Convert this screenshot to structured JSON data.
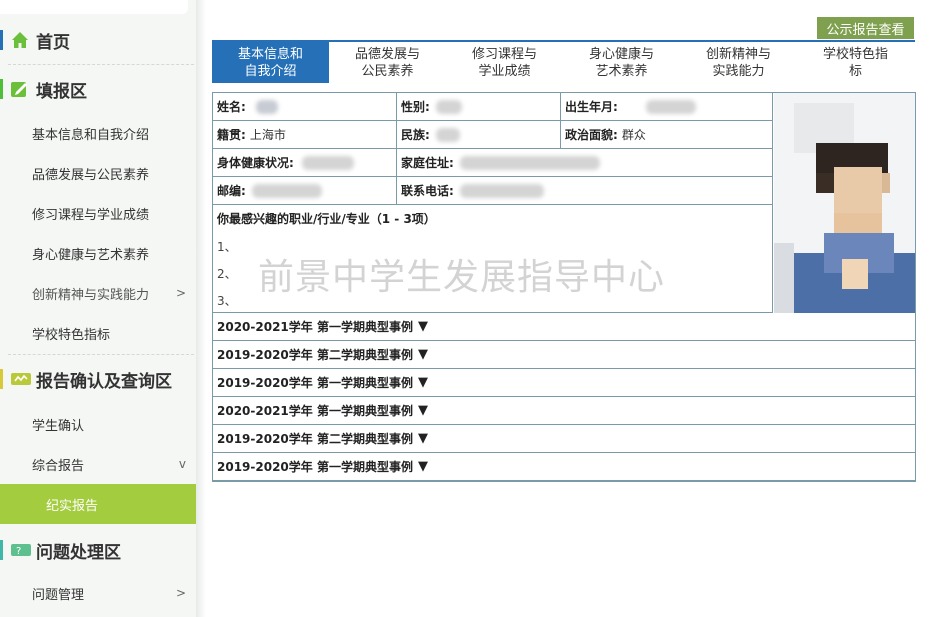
{
  "sidebar": {
    "home_label": "首页",
    "fill_section": "填报区",
    "fill_items": [
      {
        "label": "基本信息和自我介绍"
      },
      {
        "label": "品德发展与公民素养"
      },
      {
        "label": "修习课程与学业成绩"
      },
      {
        "label": "身心健康与艺术素养"
      },
      {
        "label": "创新精神与实践能力",
        "chevron": ">"
      },
      {
        "label": "学校特色指标"
      }
    ],
    "report_section": "报告确认及查询区",
    "report_items": [
      {
        "label": "学生确认"
      },
      {
        "label": "综合报告",
        "chevron": "v"
      },
      {
        "label": "纪实报告"
      }
    ],
    "issue_section": "问题处理区",
    "issue_items": [
      {
        "label": "问题管理",
        "chevron": ">"
      }
    ]
  },
  "public_report_button": "公示报告查看",
  "tabs": [
    {
      "label": "基本信息和\n自我介绍"
    },
    {
      "label": "品德发展与\n公民素养"
    },
    {
      "label": "修习课程与\n学业成绩"
    },
    {
      "label": "身心健康与\n艺术素养"
    },
    {
      "label": "创新精神与\n实践能力"
    },
    {
      "label": "学校特色指\n标"
    }
  ],
  "form": {
    "name_label": "姓名:",
    "gender_label": "性别:",
    "birth_label": "出生年月:",
    "native_label": "籍贯:",
    "native_value": "上海市",
    "ethnic_label": "民族:",
    "political_label": "政治面貌:",
    "political_value": "群众",
    "health_label": "身体健康状况:",
    "address_label": "家庭住址:",
    "zip_label": "邮编:",
    "phone_label": "联系电话:",
    "interest_title": "你最感兴趣的职业/行业/专业（1 - 3项）",
    "interest_lines": [
      "1、",
      "2、",
      "3、"
    ]
  },
  "case_rows": [
    {
      "label": "2020-2021学年 第一学期典型事例"
    },
    {
      "label": "2019-2020学年 第二学期典型事例"
    },
    {
      "label": "2019-2020学年 第一学期典型事例"
    },
    {
      "label": "2020-2021学年 第一学期典型事例"
    },
    {
      "label": "2019-2020学年 第二学期典型事例"
    },
    {
      "label": "2019-2020学年 第一学期典型事例"
    }
  ],
  "watermark": "前景中学生发展指导中心",
  "colors": {
    "tab_active": "#2670b8",
    "nav_active": "#a3cc3e",
    "button_green": "#7fa04f",
    "border": "#7a9aa8"
  }
}
